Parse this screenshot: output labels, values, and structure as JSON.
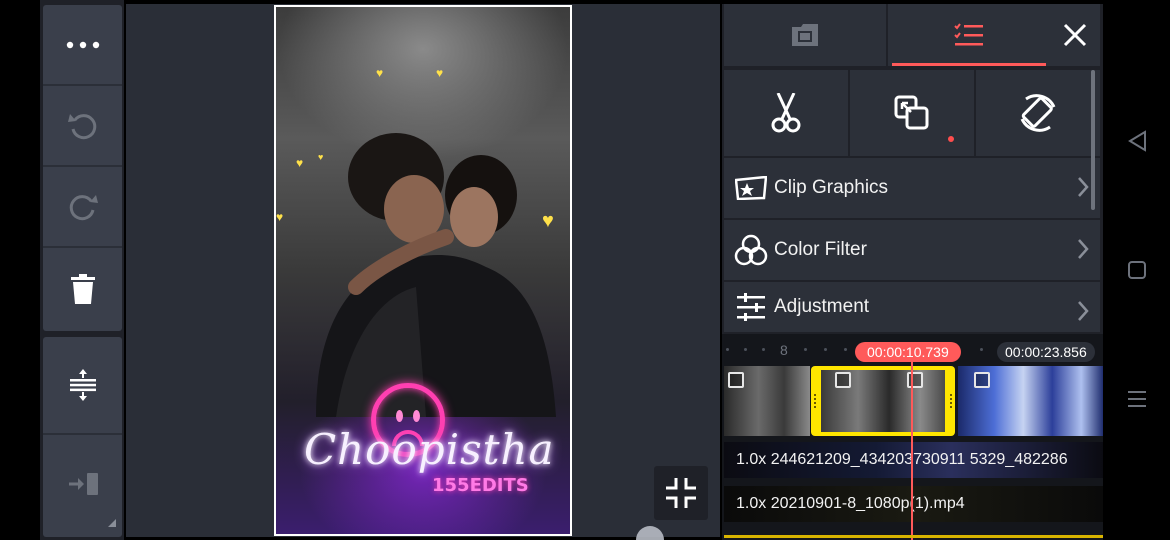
{
  "left_toolbar": {
    "buttons": [
      {
        "name": "more-options",
        "icon": "more-horizontal-icon"
      },
      {
        "name": "undo",
        "icon": "undo-icon"
      },
      {
        "name": "redo",
        "icon": "redo-icon"
      },
      {
        "name": "delete",
        "icon": "trash-icon"
      },
      {
        "name": "track-height",
        "icon": "expand-vertical-icon"
      },
      {
        "name": "export",
        "icon": "import-arrow-icon"
      }
    ]
  },
  "preview": {
    "overlay_script_text": "Choopistha",
    "overlay_edits_text": "155EDITS",
    "collapse_icon": "collapse-icon"
  },
  "panel": {
    "tabs": [
      {
        "name": "media",
        "icon": "film-icon",
        "active": false
      },
      {
        "name": "edit",
        "icon": "checklist-icon",
        "active": true
      }
    ],
    "close_icon": "close-icon",
    "tools": [
      {
        "name": "split",
        "icon": "scissors-icon"
      },
      {
        "name": "crop",
        "icon": "crop-icon"
      },
      {
        "name": "rotate",
        "icon": "rotate-icon"
      }
    ],
    "menu_items": [
      {
        "label": "Clip Graphics",
        "icon": "clip-graphics-icon"
      },
      {
        "label": "Color Filter",
        "icon": "color-filter-icon"
      },
      {
        "label": "Adjustment",
        "icon": "sliders-icon"
      }
    ]
  },
  "timeline": {
    "ruler_mark": "8",
    "current_time": "00:00:10.739",
    "total_time": "00:00:23.856",
    "layers": [
      {
        "label": "1.0x 244621209_434203730911 5329_482286"
      },
      {
        "label": "1.0x 20210901-8_1080p(1).mp4"
      }
    ]
  },
  "colors": {
    "accent": "#ff5a5a",
    "selected_clip": "#ffe600",
    "panel_bg": "#2c3039"
  }
}
